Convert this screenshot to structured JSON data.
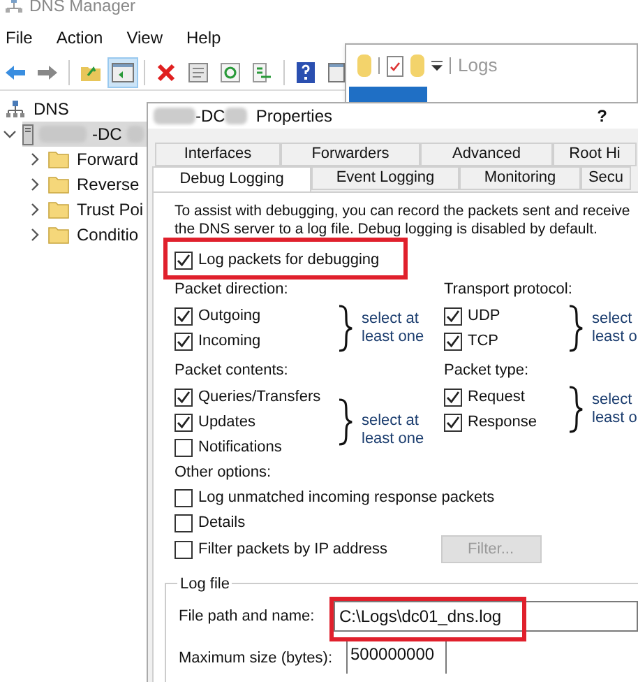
{
  "dns_manager": {
    "title": "DNS Manager",
    "menu": [
      "File",
      "Action",
      "View",
      "Help"
    ],
    "tree": [
      {
        "label": "DNS",
        "expanded": true,
        "selected": false,
        "children": [
          {
            "label": "-DC",
            "expanded": true,
            "selected": true,
            "children": [
              {
                "label": "Forward",
                "expanded": false,
                "selected": false
              },
              {
                "label": "Reverse",
                "expanded": false,
                "selected": false
              },
              {
                "label": "Trust Poi",
                "expanded": false,
                "selected": false
              },
              {
                "label": "Conditio",
                "expanded": false,
                "selected": false
              }
            ]
          }
        ]
      }
    ]
  },
  "explorer": {
    "title": "Logs"
  },
  "dialog": {
    "title_parts": [
      "-DC",
      "Properties"
    ],
    "help": "?",
    "tab_rows": [
      [
        {
          "label": "Interfaces",
          "selected": false
        },
        {
          "label": "Forwarders",
          "selected": false
        },
        {
          "label": "Advanced",
          "selected": false
        },
        {
          "label": "Root Hi",
          "selected": false
        }
      ],
      [
        {
          "label": "Debug Logging",
          "selected": true
        },
        {
          "label": "Event Logging",
          "selected": false
        },
        {
          "label": "Monitoring",
          "selected": false
        },
        {
          "label": "Secu",
          "selected": false
        }
      ]
    ],
    "intro": [
      "To assist with debugging, you can record the packets sent and receive",
      "the DNS server to a log file. Debug logging is disabled by default."
    ],
    "log_packets": {
      "label": "Log packets for debugging",
      "checked": true
    },
    "groups": [
      {
        "title": "Packet direction:",
        "options": [
          {
            "label": "Outgoing",
            "checked": true
          },
          {
            "label": "Incoming",
            "checked": true
          }
        ],
        "note": [
          "select at",
          "least one"
        ]
      },
      {
        "title": "Transport protocol:",
        "options": [
          {
            "label": "UDP",
            "checked": true
          },
          {
            "label": "TCP",
            "checked": true
          }
        ],
        "note": [
          "select",
          "least o"
        ]
      },
      {
        "title": "Packet contents:",
        "options": [
          {
            "label": "Queries/Transfers",
            "checked": true
          },
          {
            "label": "Updates",
            "checked": true
          },
          {
            "label": "Notifications",
            "checked": false
          }
        ],
        "note": [
          "select at",
          "least one"
        ]
      },
      {
        "title": "Packet type:",
        "options": [
          {
            "label": "Request",
            "checked": true
          },
          {
            "label": "Response",
            "checked": true
          }
        ],
        "note": [
          "select",
          "least o"
        ]
      }
    ],
    "other_options": {
      "title": "Other options:",
      "options": [
        {
          "label": "Log unmatched incoming response packets",
          "checked": false
        },
        {
          "label": "Details",
          "checked": false
        },
        {
          "label": "Filter packets by IP address",
          "checked": false
        }
      ]
    },
    "filter_button": {
      "label": "Filter...",
      "disabled": true
    },
    "log_file": {
      "title": "Log file",
      "path_label": "File path and name:",
      "path": "C:\\Logs\\dc01_dns.log",
      "max_label": "Maximum size (bytes):",
      "max_size": "500000000"
    }
  }
}
